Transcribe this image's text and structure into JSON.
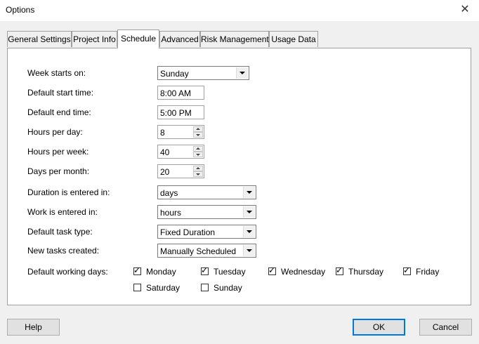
{
  "window": {
    "title": "Options",
    "close_glyph": "✕"
  },
  "tabs": [
    {
      "label": "General Settings",
      "active": false
    },
    {
      "label": "Project Info",
      "active": false
    },
    {
      "label": "Schedule",
      "active": true
    },
    {
      "label": "Advanced",
      "active": false
    },
    {
      "label": "Risk Management",
      "active": false
    },
    {
      "label": "Usage Data",
      "active": false
    }
  ],
  "schedule": {
    "week_starts_on": {
      "label": "Week starts on:",
      "value": "Sunday"
    },
    "default_start_time": {
      "label": "Default start time:",
      "value": "8:00 AM"
    },
    "default_end_time": {
      "label": "Default end time:",
      "value": "5:00 PM"
    },
    "hours_per_day": {
      "label": "Hours per day:",
      "value": "8"
    },
    "hours_per_week": {
      "label": "Hours per week:",
      "value": "40"
    },
    "days_per_month": {
      "label": "Days per month:",
      "value": "20"
    },
    "duration_entered_in": {
      "label": "Duration is entered in:",
      "value": "days"
    },
    "work_entered_in": {
      "label": "Work is entered in:",
      "value": "hours"
    },
    "default_task_type": {
      "label": "Default task type:",
      "value": "Fixed Duration"
    },
    "new_tasks_created": {
      "label": "New tasks created:",
      "value": "Manually Scheduled"
    },
    "default_working_days": {
      "label": "Default working days:",
      "check_glyph": "✓",
      "days": [
        {
          "label": "Monday",
          "checked": true
        },
        {
          "label": "Tuesday",
          "checked": true
        },
        {
          "label": "Wednesday",
          "checked": true
        },
        {
          "label": "Thursday",
          "checked": true
        },
        {
          "label": "Friday",
          "checked": true
        },
        {
          "label": "Saturday",
          "checked": false
        },
        {
          "label": "Sunday",
          "checked": false
        }
      ]
    }
  },
  "buttons": {
    "help": "Help",
    "ok": "OK",
    "cancel": "Cancel"
  }
}
